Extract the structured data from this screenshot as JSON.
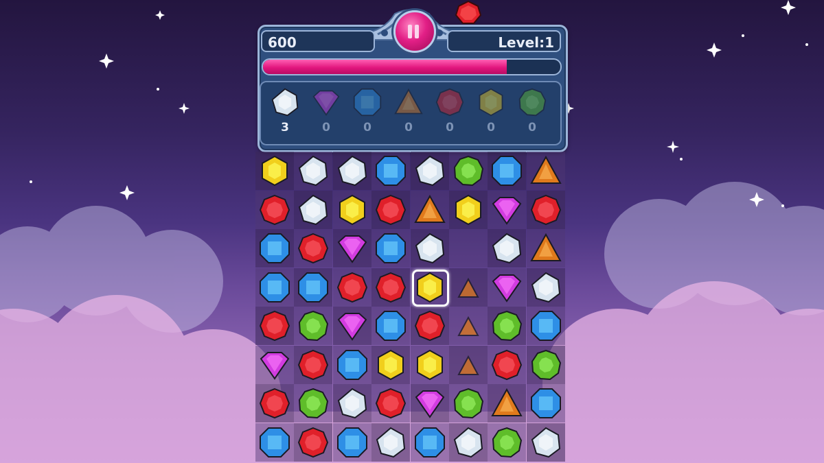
{
  "hud": {
    "score": "600",
    "level": "Level:1",
    "progress": 0.82,
    "pause_label": "pause"
  },
  "goals": [
    {
      "gem": "white",
      "count": "3",
      "done": true
    },
    {
      "gem": "purple",
      "count": "0",
      "done": false
    },
    {
      "gem": "blue",
      "count": "0",
      "done": false
    },
    {
      "gem": "orange",
      "count": "0",
      "done": false
    },
    {
      "gem": "red",
      "count": "0",
      "done": false
    },
    {
      "gem": "yellow",
      "count": "0",
      "done": false
    },
    {
      "gem": "green",
      "count": "0",
      "done": false
    }
  ],
  "board": {
    "rows": 8,
    "cols": 8,
    "grid": [
      [
        "yellow",
        "white",
        "white",
        "blue",
        "white",
        "green",
        "blue",
        "orange"
      ],
      [
        "red",
        "white",
        "yellow",
        "red",
        "orange",
        "yellow",
        "purple",
        "red"
      ],
      [
        "blue",
        "red",
        "purple",
        "blue",
        "white",
        "",
        "white",
        "orange"
      ],
      [
        "blue",
        "blue",
        "red",
        "red",
        "yellow",
        "orange-small",
        "purple",
        "white"
      ],
      [
        "red",
        "green",
        "purple",
        "blue",
        "red",
        "orange-small",
        "green",
        "blue"
      ],
      [
        "purple",
        "red",
        "blue",
        "yellow",
        "yellow",
        "orange-small",
        "red",
        "green"
      ],
      [
        "red",
        "green",
        "white",
        "red",
        "purple",
        "green",
        "orange",
        "blue"
      ],
      [
        "blue",
        "red",
        "blue",
        "white",
        "blue",
        "white",
        "green",
        "white"
      ]
    ],
    "selected": {
      "row": 3,
      "col": 4
    }
  },
  "colors": {
    "red": "#e0202a",
    "blue": "#2e8fe6",
    "white": "#d8e4ef",
    "yellow": "#f1cf1c",
    "green": "#5fbd2a",
    "purple": "#d23ce0",
    "orange": "#e07a1c",
    "accent_pink": "#e2167e"
  }
}
